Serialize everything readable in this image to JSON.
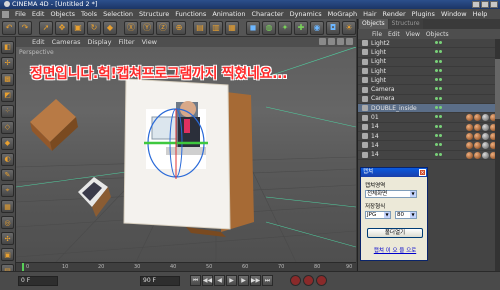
{
  "window": {
    "title": "CINEMA 4D - [Untitled 2 *]"
  },
  "menu": [
    "File",
    "Edit",
    "Objects",
    "Tools",
    "Selection",
    "Structure",
    "Functions",
    "Animation",
    "Character",
    "Dynamics",
    "MoGraph",
    "Hair",
    "Render",
    "Plugins",
    "Window",
    "Help"
  ],
  "viewport": {
    "menu": [
      "Edit",
      "Cameras",
      "Display",
      "Filter",
      "View"
    ],
    "label": "Perspective"
  },
  "overlay_text": "정면입니다.헉!캡쳐프로그램까지 찍혔네요...",
  "objects_panel": {
    "tabs": [
      "Objects",
      "Structure"
    ],
    "menu": [
      "File",
      "Edit",
      "View",
      "Objects"
    ],
    "rows": [
      "Light2",
      "Light",
      "Light",
      "Light",
      "Light",
      "Camera",
      "Camera",
      "DOUBLE_inside",
      "01",
      "14",
      "14",
      "14",
      "14"
    ]
  },
  "timeline": {
    "ticks": [
      "0",
      "10",
      "20",
      "30",
      "40",
      "50",
      "60",
      "70",
      "80",
      "90"
    ]
  },
  "transport": {
    "start_frame": "0 F",
    "end_frame": "90 F"
  },
  "capture_dialog": {
    "title": "캡쳐 ",
    "area_label": "캡쳐영역",
    "area_value": "전체화면",
    "format_label": "저장형식",
    "format_value": "JPG",
    "quality_value": "80",
    "open_folder_button": "폴더열기",
    "help_link": "캡쳐 이 오 을 으로"
  },
  "colors": {
    "overlay_text": "#ff2a2a",
    "viewport": "#5e5e5e",
    "axis_green": "#3ec83e",
    "axis_red": "#e03030",
    "selection": "#5b6e88"
  }
}
